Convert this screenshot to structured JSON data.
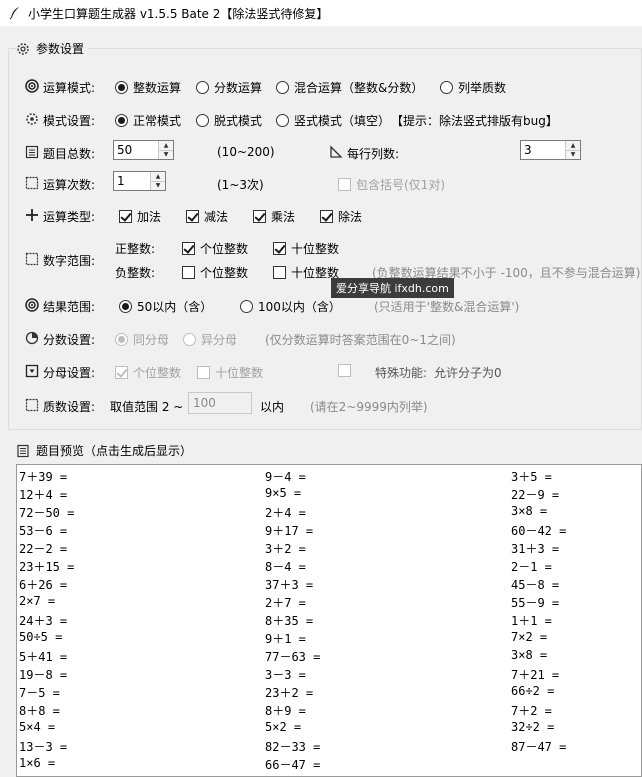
{
  "window": {
    "title": "小学生口算题生成器 v1.5.5 Bate 2【除法竖式待修复】"
  },
  "params_group": {
    "label": "参数设置"
  },
  "mode_row": {
    "label": "运算模式:",
    "options": [
      "整数运算",
      "分数运算",
      "混合运算（整数&分数）",
      "列举质数"
    ],
    "selected": "整数运算"
  },
  "style_row": {
    "label": "模式设置:",
    "options": [
      "正常模式",
      "脱式模式",
      "竖式模式（填空）"
    ],
    "selected": "正常模式",
    "tip": "【提示：除法竖式排版有bug】"
  },
  "total_row": {
    "label": "题目总数:",
    "value": "50",
    "range": "(10~200)",
    "cols_label": "每行列数:",
    "cols_value": "3"
  },
  "ops_count_row": {
    "label": "运算次数:",
    "value": "1",
    "range": "(1~3次)",
    "bracket_label": "包含括号(仅1对)"
  },
  "op_type_row": {
    "label": "运算类型:",
    "options": [
      "加法",
      "减法",
      "乘法",
      "除法"
    ]
  },
  "number_range_row": {
    "label": "数字范围:",
    "positive_label": "正整数:",
    "positive_options": [
      "个位整数",
      "十位整数"
    ],
    "negative_label": "负整数:",
    "negative_options": [
      "个位整数",
      "十位整数"
    ],
    "negative_note": "(负整数运算结果不小于 -100，且不参与混合运算)"
  },
  "tooltip": {
    "text": "爱分享导航 ifxdh.com"
  },
  "result_row": {
    "label": "结果范围:",
    "options": [
      "50以内（含）",
      "100以内（含）"
    ],
    "selected": "50以内（含）",
    "note": "(只适用于'整数&混合运算')"
  },
  "fraction_row": {
    "label": "分数设置:",
    "options": [
      "同分母",
      "异分母"
    ],
    "note": "(仅分数运算时答案范围在0~1之间)"
  },
  "denominator_row": {
    "label": "分母设置:",
    "options": [
      "个位整数",
      "十位整数"
    ],
    "special_label": "特殊功能:",
    "special_value": "允许分子为0"
  },
  "prime_row": {
    "label": "质数设置:",
    "range_label": "取值范围 2 ~",
    "value": "100",
    "unit": "以内",
    "note": "(请在2~9999内列举)"
  },
  "preview_group": {
    "label": "题目预览（点击生成后显示）"
  },
  "preview_rows": [
    [
      "7＋39 =",
      "9－4 =",
      "3＋5 ="
    ],
    [
      "12＋4 =",
      "9×5 =",
      "22－9 ="
    ],
    [
      "72－50 =",
      "2＋4 =",
      "3×8 ="
    ],
    [
      "53－6 =",
      "9＋17 =",
      "60－42 ="
    ],
    [
      "22－2 =",
      "3＋2 =",
      "31＋3 ="
    ],
    [
      "23＋15 =",
      "8－4 =",
      "2－1 ="
    ],
    [
      "6＋26 =",
      "37＋3 =",
      "45－8 ="
    ],
    [
      "2×7 =",
      "2＋7 =",
      "55－9 ="
    ],
    [
      "24＋3 =",
      "8＋35 =",
      "1＋1 ="
    ],
    [
      "50÷5 =",
      "9＋1 =",
      "7×2 ="
    ],
    [
      "5＋41 =",
      "77－63 =",
      "3×8 ="
    ],
    [
      "19－8 =",
      "3－3 =",
      "7＋21 ="
    ],
    [
      "7－5 =",
      "23＋2 =",
      "66÷2 ="
    ],
    [
      "8＋8 =",
      "8＋9 =",
      "7＋2 ="
    ],
    [
      "5×4 =",
      "5×2 =",
      "32÷2 ="
    ],
    [
      "13－3 =",
      "82－33 =",
      "87－47 ="
    ],
    [
      "1×6 =",
      "66－47 =",
      ""
    ]
  ]
}
